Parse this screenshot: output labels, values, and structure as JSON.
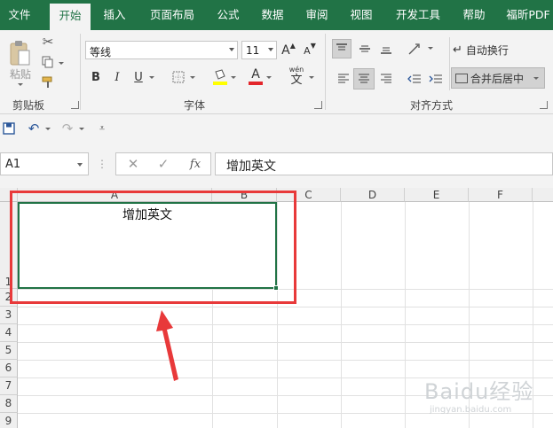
{
  "ribbon_tabs": [
    "文件",
    "开始",
    "插入",
    "页面布局",
    "公式",
    "数据",
    "审阅",
    "视图",
    "开发工具",
    "帮助",
    "福昕PDF"
  ],
  "clipboard": {
    "paste_label": "粘贴",
    "group_label": "剪贴板"
  },
  "font": {
    "name": "等线",
    "size": "11",
    "group_label": "字体",
    "grow_label": "A",
    "shrink_label": "A",
    "bold": "B",
    "italic": "I",
    "underline": "U",
    "color_letter": "A",
    "phonetic_label": "wén",
    "phonetic_char": "文"
  },
  "alignment": {
    "wrap_label": "自动换行",
    "merge_label": "合并后居中",
    "group_label": "对齐方式"
  },
  "name_box": {
    "value": "A1"
  },
  "formula_bar": {
    "fx": "fx",
    "value": "增加英文"
  },
  "columns": [
    "A",
    "B",
    "C",
    "D",
    "E",
    "F"
  ],
  "rows": [
    "1",
    "2",
    "3",
    "4",
    "5",
    "6",
    "7",
    "8",
    "9"
  ],
  "cell_a1": "增加英文",
  "watermark": {
    "main": "Baidu经验",
    "sub": "jingyan.baidu.com"
  },
  "colors": {
    "accent": "#217346",
    "annotation": "#e8393a"
  }
}
